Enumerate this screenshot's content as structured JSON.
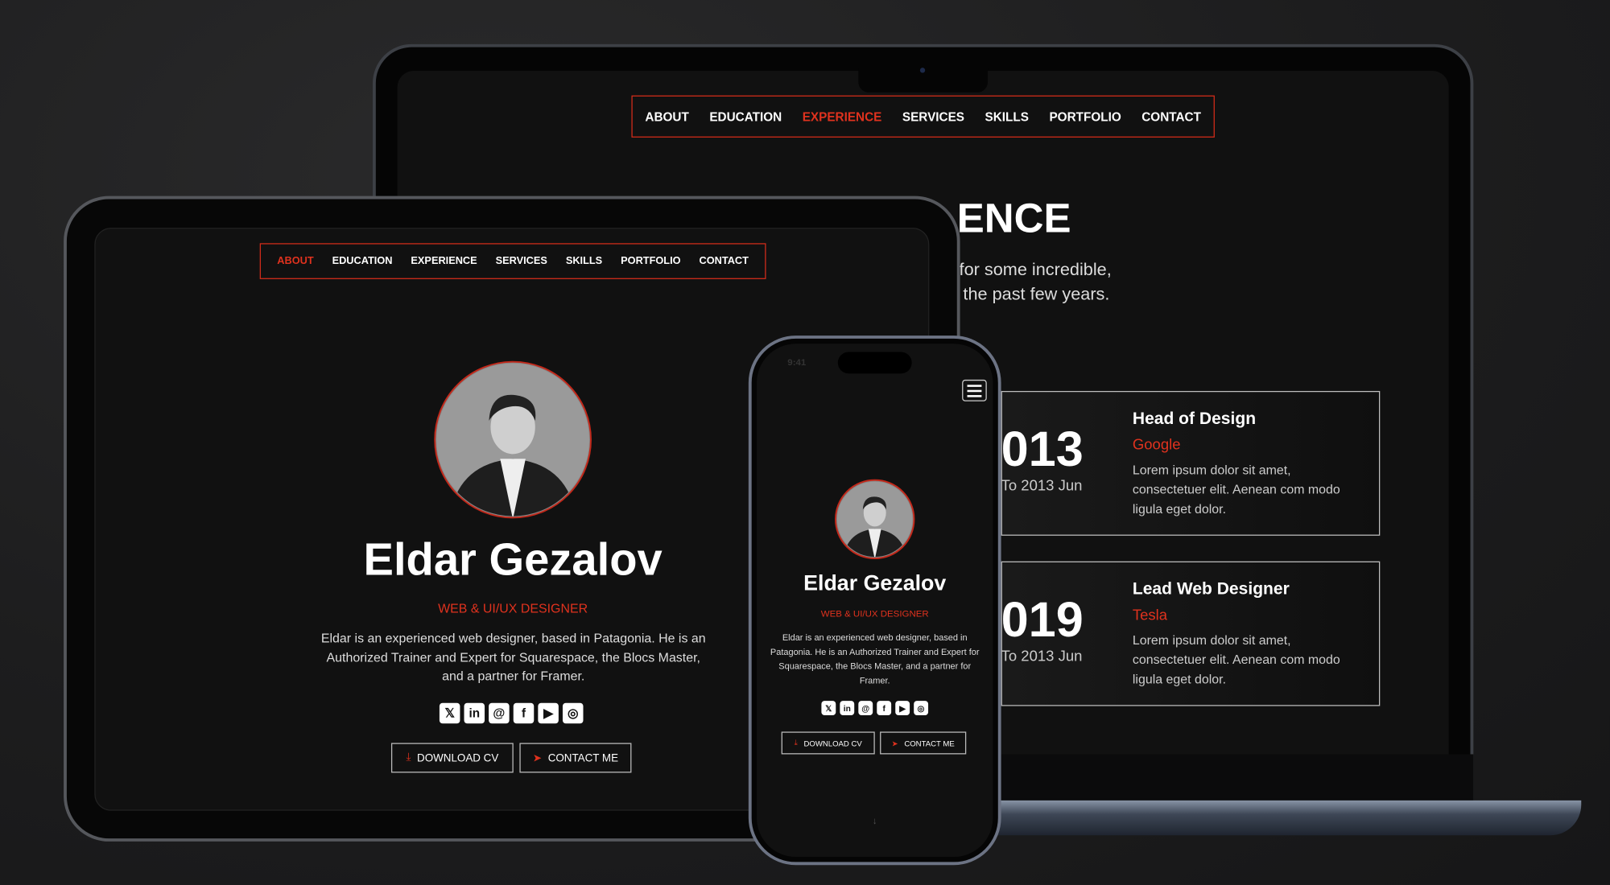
{
  "colors": {
    "accent": "#e0321e",
    "background": "#111111"
  },
  "laptop": {
    "nav": [
      {
        "label": "ABOUT"
      },
      {
        "label": "EDUCATION"
      },
      {
        "label": "EXPERIENCE",
        "active": true
      },
      {
        "label": "SERVICES"
      },
      {
        "label": "SKILLS"
      },
      {
        "label": "PORTFOLIO"
      },
      {
        "label": "CONTACT"
      }
    ],
    "heading": "ENCE",
    "intro_line1": "g for some incredible,",
    "intro_line2": "the past few years.",
    "cards": [
      {
        "year": "013",
        "range": "To 2013 Jun",
        "title": "Head of Design",
        "company": "Google",
        "description": "Lorem ipsum dolor sit amet, consectetuer elit. Aenean com modo ligula eget dolor."
      },
      {
        "year": "019",
        "range": "To 2013 Jun",
        "title": "Lead Web Designer",
        "company": "Tesla",
        "description": "Lorem ipsum dolor sit amet, consectetuer elit. Aenean com modo ligula eget dolor."
      }
    ]
  },
  "tablet": {
    "nav": [
      {
        "label": "ABOUT",
        "active": true
      },
      {
        "label": "EDUCATION"
      },
      {
        "label": "EXPERIENCE"
      },
      {
        "label": "SERVICES"
      },
      {
        "label": "SKILLS"
      },
      {
        "label": "PORTFOLIO"
      },
      {
        "label": "CONTACT"
      }
    ]
  },
  "profile": {
    "name": "Eldar Gezalov",
    "role": "WEB & UI/UX DESIGNER",
    "bio": "Eldar is an experienced web designer, based in Patagonia. He is an Authorized Trainer and Expert for Squarespace, the Blocs Master, and a partner for Framer.",
    "social": [
      {
        "icon": "x-icon",
        "glyph": "𝕏"
      },
      {
        "icon": "linkedin-icon",
        "glyph": "in"
      },
      {
        "icon": "threads-icon",
        "glyph": "@"
      },
      {
        "icon": "facebook-icon",
        "glyph": "f"
      },
      {
        "icon": "youtube-icon",
        "glyph": "▶"
      },
      {
        "icon": "instagram-icon",
        "glyph": "◎"
      }
    ],
    "download_cv": "DOWNLOAD CV",
    "contact_me": "CONTACT ME"
  },
  "phone": {
    "time": "9:41",
    "scroll_arrow": "↓"
  }
}
